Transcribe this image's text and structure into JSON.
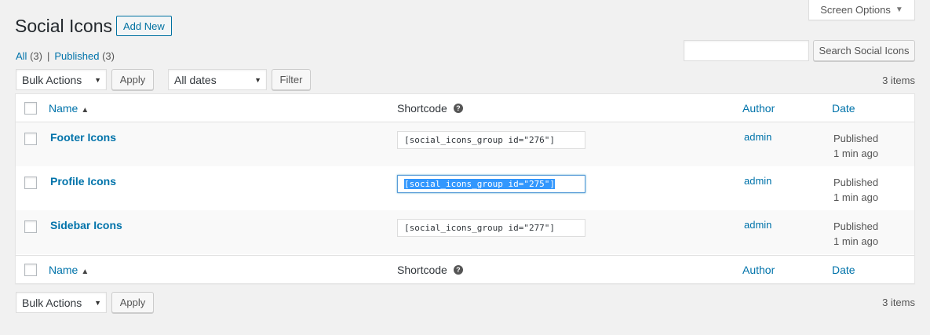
{
  "screen_options": {
    "label": "Screen Options"
  },
  "header": {
    "title": "Social Icons",
    "add_new": "Add New"
  },
  "views": {
    "all_label": "All",
    "all_count": "(3)",
    "separator": "|",
    "published_label": "Published",
    "published_count": "(3)"
  },
  "search": {
    "value": "",
    "button": "Search Social Icons"
  },
  "top_nav": {
    "bulk_actions": "Bulk Actions",
    "apply": "Apply",
    "dates": "All dates",
    "filter": "Filter",
    "items": "3 items"
  },
  "bottom_nav": {
    "bulk_actions": "Bulk Actions",
    "apply": "Apply",
    "items": "3 items"
  },
  "columns": {
    "name": "Name",
    "shortcode": "Shortcode",
    "author": "Author",
    "date": "Date",
    "help": "?"
  },
  "rows": [
    {
      "title": "Footer Icons",
      "shortcode": "[social_icons_group id=\"276\"]",
      "author": "admin",
      "status": "Published",
      "time": "1 min ago"
    },
    {
      "title": "Profile Icons",
      "shortcode": "[social_icons_group id=\"275\"]",
      "author": "admin",
      "status": "Published",
      "time": "1 min ago"
    },
    {
      "title": "Sidebar Icons",
      "shortcode": "[social_icons_group id=\"277\"]",
      "author": "admin",
      "status": "Published",
      "time": "1 min ago"
    }
  ]
}
